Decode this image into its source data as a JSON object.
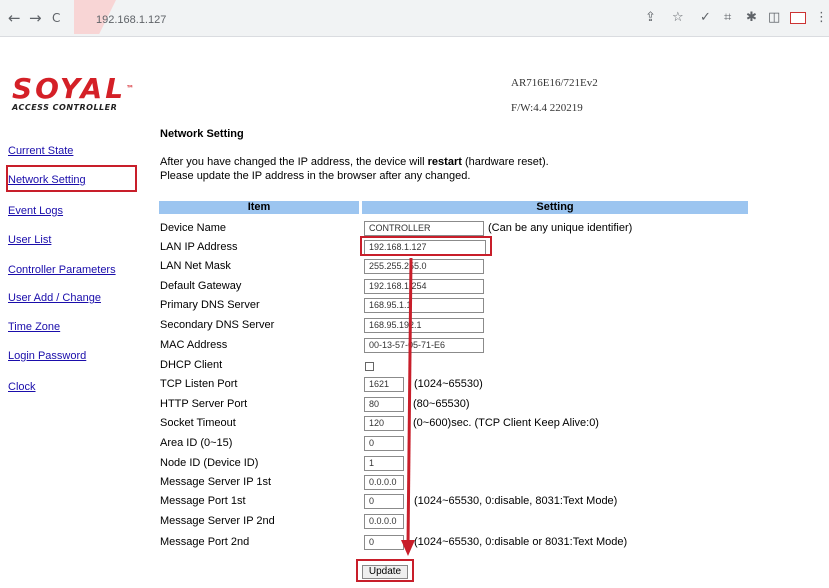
{
  "browser": {
    "url": "192.168.1.127",
    "nav": {
      "back": "←",
      "forward": "→",
      "reload": "C"
    },
    "toolbar_icons": [
      "share-icon",
      "star-icon",
      "check-icon",
      "screenshot-icon",
      "extensions-icon",
      "sidebar-icon",
      "profile-icon",
      "menu-icon"
    ]
  },
  "header": {
    "logo_text": "SOYAL",
    "logo_tm": "™",
    "logo_sub": "ACCESS CONTROLLER",
    "model": "AR716E16/721Ev2",
    "firmware": "F/W:4.4 220219"
  },
  "sidebar": {
    "items": [
      {
        "label": "Current State"
      },
      {
        "label": "Network Setting"
      },
      {
        "label": "Event Logs"
      },
      {
        "label": "User List"
      },
      {
        "label": "Controller Parameters"
      },
      {
        "label": "User Add / Change"
      },
      {
        "label": "Time Zone"
      },
      {
        "label": "Login Password"
      },
      {
        "label": "Clock"
      }
    ]
  },
  "main": {
    "title": "Network Setting",
    "note1_pre": "After you have changed the IP address, the device will ",
    "note1_bold": "restart",
    "note1_post": " (hardware reset).",
    "note2": "Please update the IP address in the browser after any changed.",
    "col_item": "Item",
    "col_setting": "Setting",
    "rows": [
      {
        "label": "Device Name",
        "value": "CONTROLLER",
        "hint": "(Can be any unique identifier)"
      },
      {
        "label": "LAN IP Address",
        "value": "192.168.1.127",
        "hint": ""
      },
      {
        "label": "LAN Net Mask",
        "value": "255.255.255.0",
        "hint": ""
      },
      {
        "label": "Default Gateway",
        "value": "192.168.1.254",
        "hint": ""
      },
      {
        "label": "Primary DNS Server",
        "value": "168.95.1.1",
        "hint": ""
      },
      {
        "label": "Secondary DNS Server",
        "value": "168.95.192.1",
        "hint": ""
      },
      {
        "label": "MAC Address",
        "value": "00-13-57-05-71-E6",
        "hint": ""
      },
      {
        "label": "DHCP Client",
        "value": "",
        "hint": ""
      },
      {
        "label": "TCP Listen Port",
        "value": "1621",
        "hint": "(1024~65530)"
      },
      {
        "label": "HTTP Server Port",
        "value": "80",
        "hint": "(80~65530)"
      },
      {
        "label": "Socket Timeout",
        "value": "120",
        "hint": "(0~600)sec. (TCP Client Keep Alive:0)"
      },
      {
        "label": "Area ID (0~15)",
        "value": "0",
        "hint": ""
      },
      {
        "label": "Node ID (Device ID)",
        "value": "1",
        "hint": ""
      },
      {
        "label": "Message Server IP 1st",
        "value": "0.0.0.0",
        "hint": ""
      },
      {
        "label": "Message Port 1st",
        "value": "0",
        "hint": "(1024~65530, 0:disable,  8031:Text Mode)"
      },
      {
        "label": "Message Server IP 2nd",
        "value": "0.0.0.0",
        "hint": ""
      },
      {
        "label": "Message Port 2nd",
        "value": "0",
        "hint": "(1024~65530, 0:disable or 8031:Text Mode)"
      }
    ],
    "update_label": "Update",
    "dhcp_checked": false
  },
  "colors": {
    "accent_red": "#c81e2a",
    "header_blue": "#9cc5f0",
    "link": "#1a0dab",
    "logo_red": "#d42027"
  }
}
